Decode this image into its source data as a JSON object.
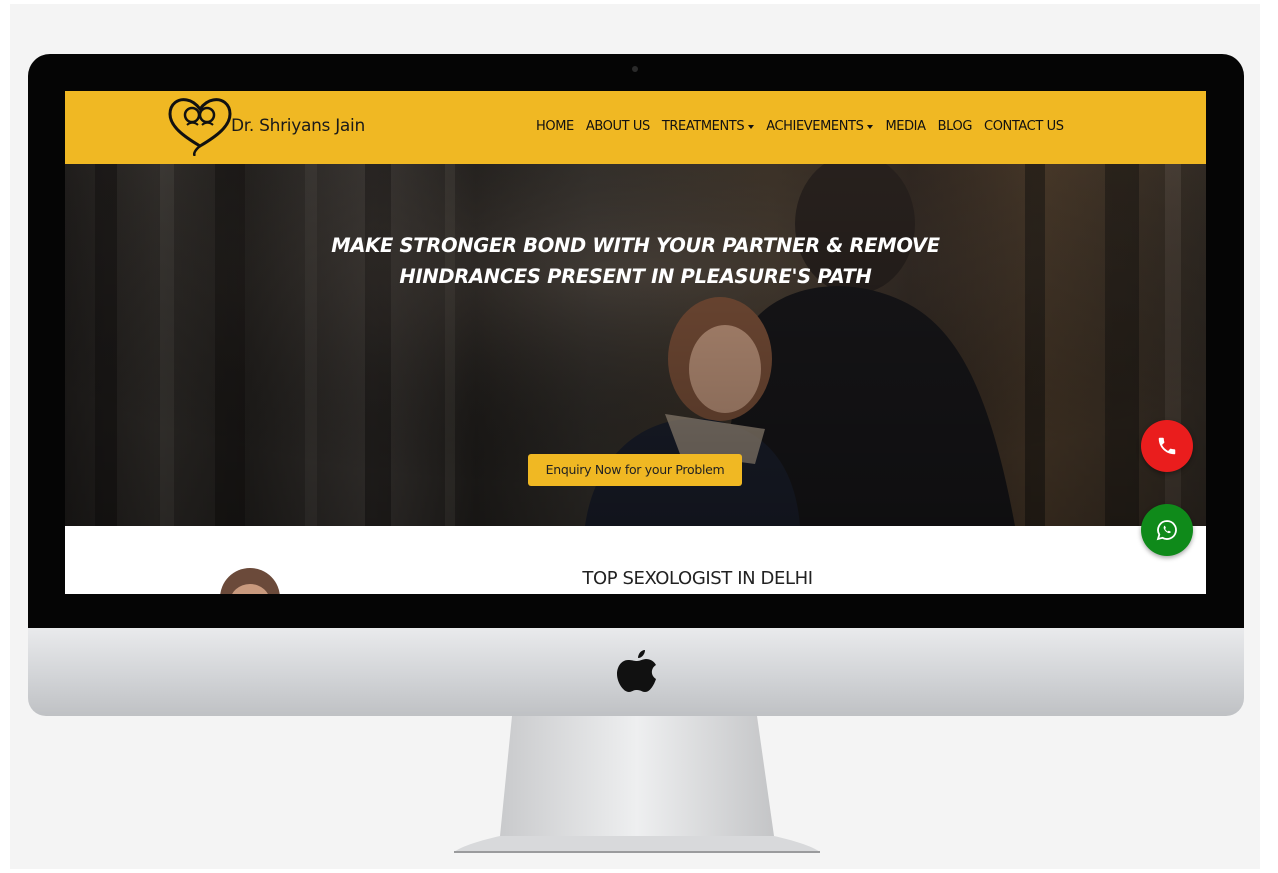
{
  "brand": {
    "name": "Dr. Shriyans Jain",
    "logo_icon": "heart-couple-logo"
  },
  "nav": {
    "items": [
      {
        "label": "HOME",
        "dropdown": false
      },
      {
        "label": "ABOUT US",
        "dropdown": false
      },
      {
        "label": "TREATMENTS",
        "dropdown": true
      },
      {
        "label": "ACHIEVEMENTS",
        "dropdown": true
      },
      {
        "label": "MEDIA",
        "dropdown": false
      },
      {
        "label": "BLOG",
        "dropdown": false
      },
      {
        "label": "CONTACT US",
        "dropdown": false
      }
    ]
  },
  "hero": {
    "title_line1": "MAKE STRONGER BOND WITH YOUR PARTNER & REMOVE",
    "title_line2": "HINDRANCES PRESENT IN PLEASURE'S PATH",
    "cta_label": "Enquiry Now for your Problem"
  },
  "content": {
    "section_title": "TOP SEXOLOGIST IN DELHI"
  },
  "floating": {
    "call_icon": "phone-icon",
    "whatsapp_icon": "whatsapp-icon"
  },
  "colors": {
    "brand_yellow": "#f0b823",
    "call_red": "#ea1d1d",
    "whatsapp_green": "#0f8a1a"
  }
}
